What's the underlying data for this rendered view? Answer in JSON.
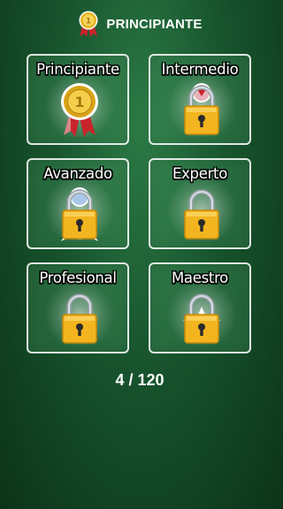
{
  "header": {
    "title": "PRINCIPIANTE",
    "icon": "medal-icon"
  },
  "levels": [
    {
      "label": "Principiante",
      "state": "unlocked",
      "icon": "medal-icon"
    },
    {
      "label": "Intermedio",
      "state": "locked",
      "icon": "lock-icon"
    },
    {
      "label": "Avanzado",
      "state": "locked",
      "icon": "lock-icon"
    },
    {
      "label": "Experto",
      "state": "locked",
      "icon": "lock-icon"
    },
    {
      "label": "Profesional",
      "state": "locked",
      "icon": "lock-icon"
    },
    {
      "label": "Maestro",
      "state": "locked",
      "icon": "lock-icon"
    }
  ],
  "progress": {
    "text": "4 / 120",
    "current": 4,
    "total": 120
  },
  "colors": {
    "background": "#17532d",
    "medal_gold": "#e6b422",
    "ribbon_red": "#c8242b",
    "lock_gold": "#f2b51f"
  }
}
